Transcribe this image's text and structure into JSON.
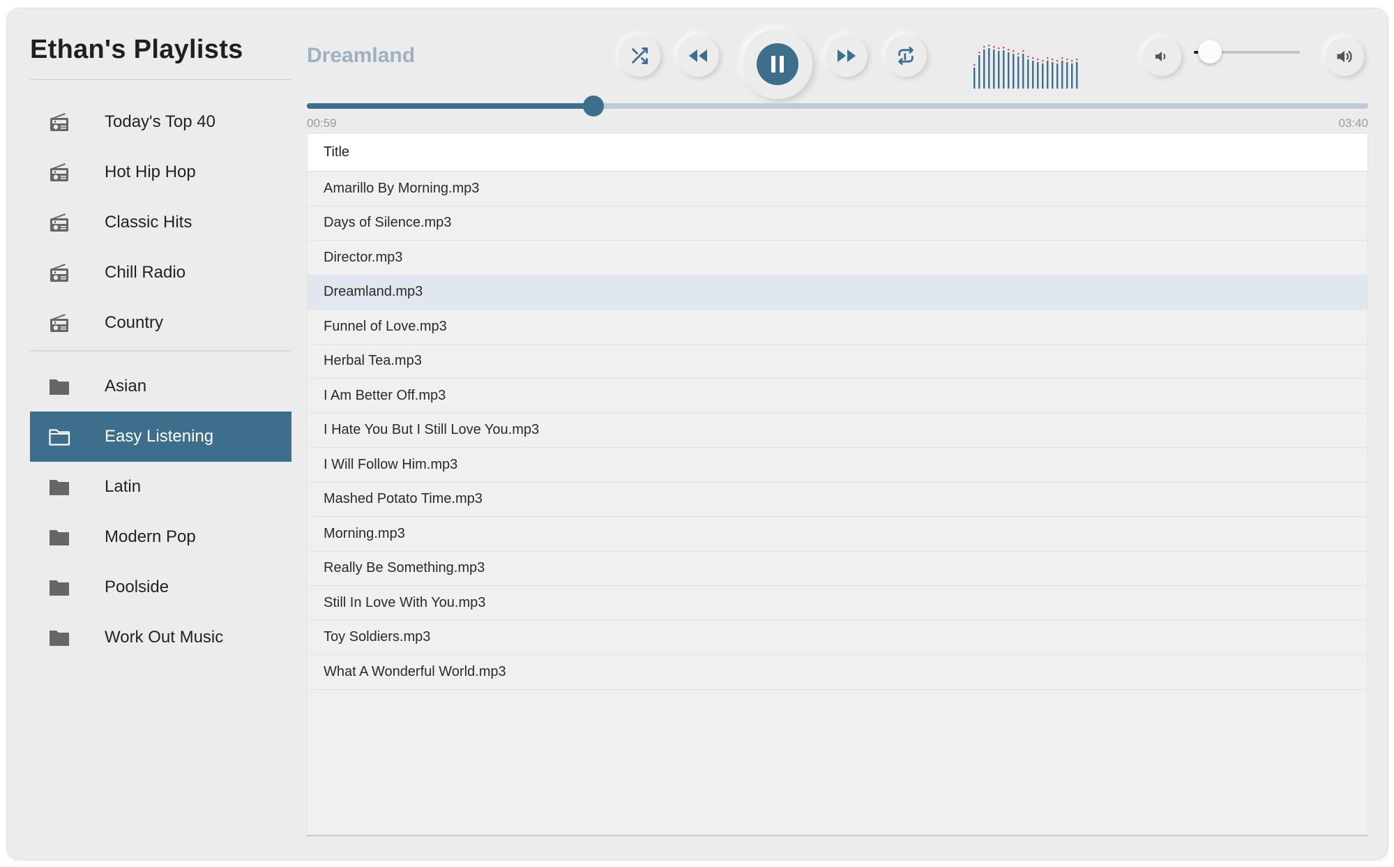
{
  "sidebar": {
    "title": "Ethan's Playlists",
    "radio_stations": [
      {
        "label": "Today's Top 40",
        "icon": "radio-icon"
      },
      {
        "label": "Hot Hip Hop",
        "icon": "radio-icon"
      },
      {
        "label": "Classic Hits",
        "icon": "radio-icon"
      },
      {
        "label": "Chill Radio",
        "icon": "radio-icon"
      },
      {
        "label": "Country",
        "icon": "radio-icon"
      }
    ],
    "playlists": [
      {
        "label": "Asian",
        "icon": "folder-icon",
        "active": false
      },
      {
        "label": "Easy Listening",
        "icon": "folder-open-icon",
        "active": true
      },
      {
        "label": "Latin",
        "icon": "folder-icon",
        "active": false
      },
      {
        "label": "Modern Pop",
        "icon": "folder-icon",
        "active": false
      },
      {
        "label": "Poolside",
        "icon": "folder-icon",
        "active": false
      },
      {
        "label": "Work Out Music",
        "icon": "folder-icon",
        "active": false
      }
    ]
  },
  "player": {
    "now_playing": "Dreamland",
    "state": "playing",
    "controls": [
      "shuffle-icon",
      "rewind-icon",
      "pause-icon",
      "fast-forward-icon",
      "repeat-icon"
    ],
    "current_time": "00:59",
    "total_time": "03:40",
    "progress_fraction": 0.27,
    "volume_fraction": 0.15,
    "volume_down_icon": "volume-low-icon",
    "volume_up_icon": "volume-high-icon",
    "visualizer_icon": "equalizer-icon"
  },
  "tracks": {
    "header": "Title",
    "selected": "Dreamland.mp3",
    "rows": [
      "Amarillo By Morning.mp3",
      "Days of Silence.mp3",
      "Director.mp3",
      "Dreamland.mp3",
      "Funnel of Love.mp3",
      "Herbal Tea.mp3",
      "I Am Better Off.mp3",
      "I Hate You But I Still Love You.mp3",
      "I Will Follow Him.mp3",
      "Mashed Potato Time.mp3",
      "Morning.mp3",
      "Really Be Something.mp3",
      "Still In Love With You.mp3",
      "Toy Soldiers.mp3",
      "What A Wonderful World.mp3"
    ]
  },
  "colors": {
    "accent": "#3d6e8c",
    "title_muted": "#9fb1bf",
    "selected_row": "#e1e7ee",
    "visualizer_peak": "#e0524f"
  }
}
